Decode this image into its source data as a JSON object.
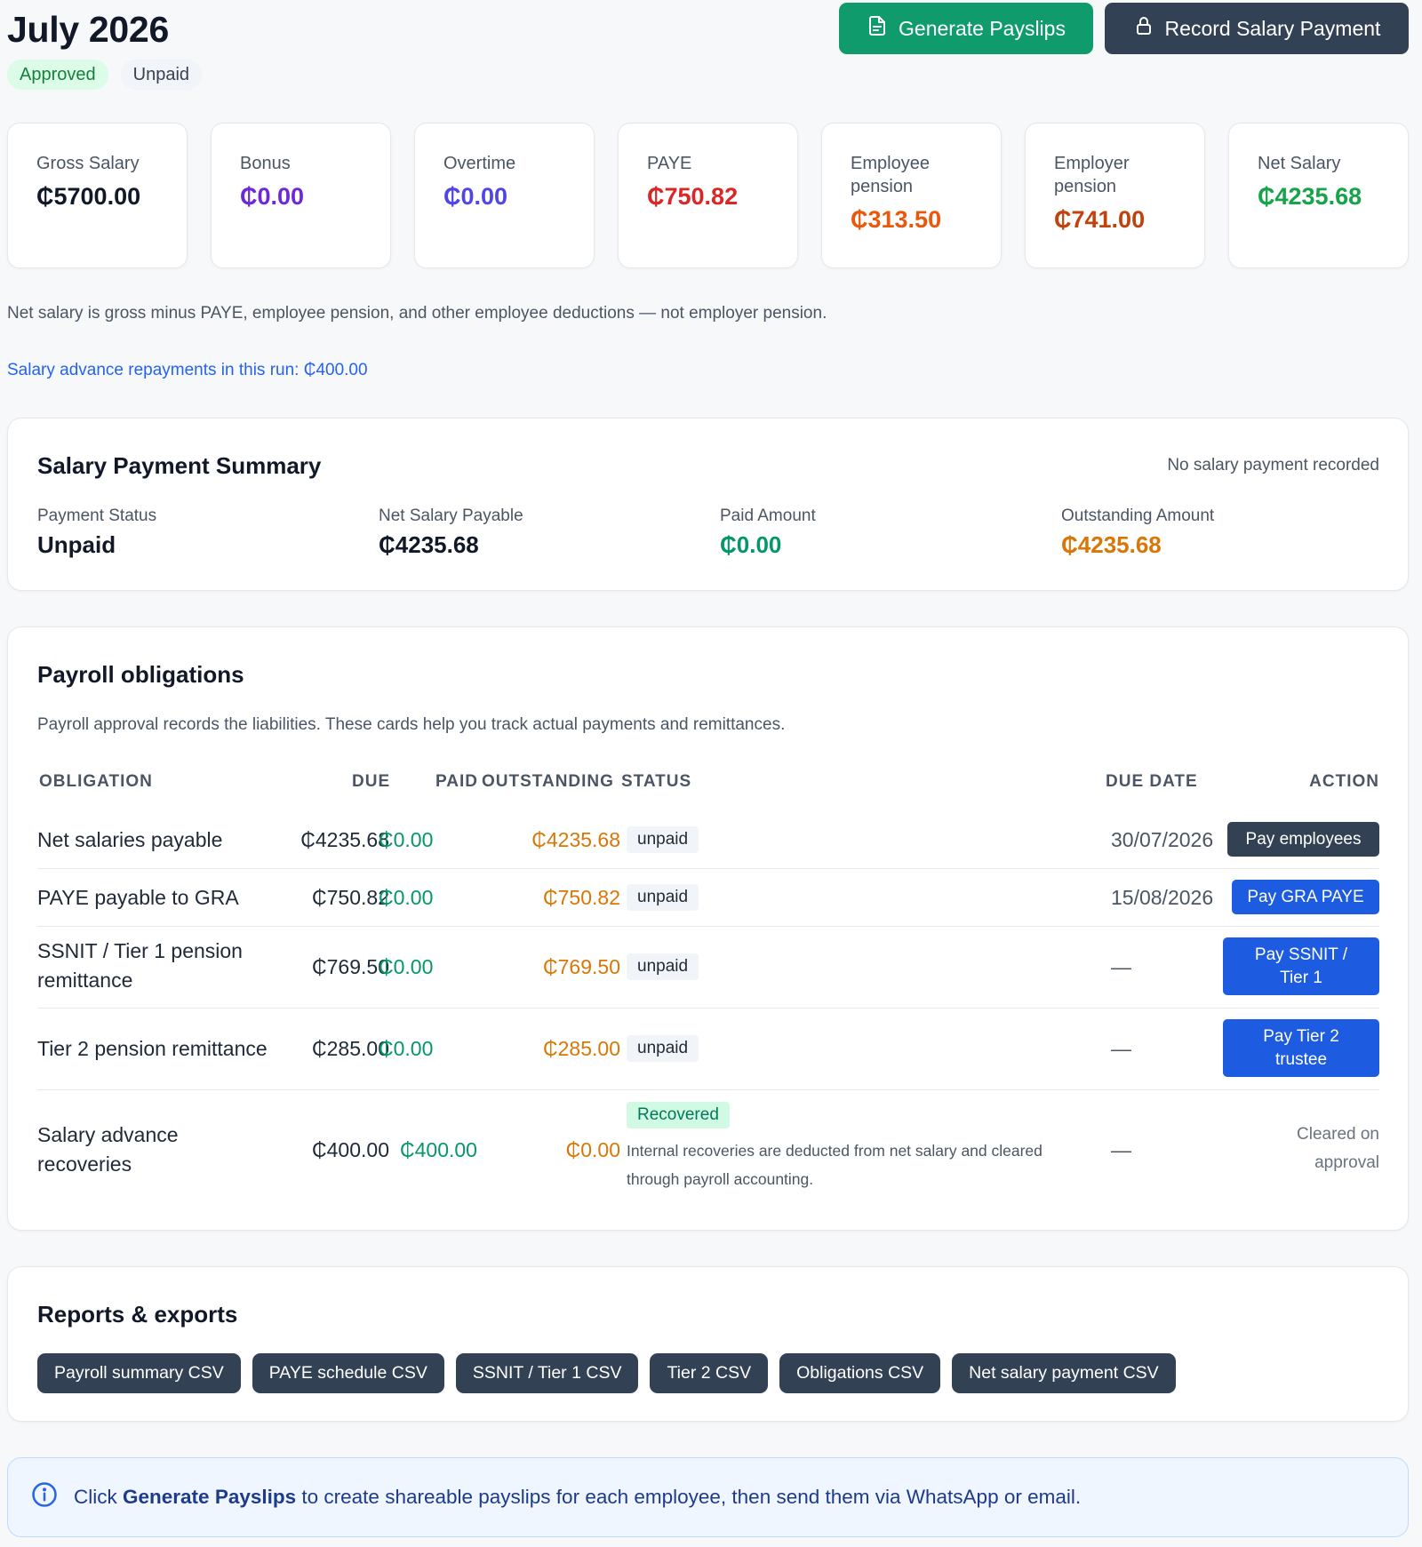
{
  "header": {
    "title": "July 2026",
    "badges": {
      "approved": "Approved",
      "unpaid": "Unpaid"
    },
    "actions": {
      "generate_payslips": "Generate Payslips",
      "record_payment": "Record Salary Payment"
    }
  },
  "stats": [
    {
      "label": "Gross Salary",
      "value": "₵5700.00",
      "color": "#111827"
    },
    {
      "label": "Bonus",
      "value": "₵0.00",
      "color": "#6d28d9"
    },
    {
      "label": "Overtime",
      "value": "₵0.00",
      "color": "#4f46e5"
    },
    {
      "label": "PAYE",
      "value": "₵750.82",
      "color": "#dc2626"
    },
    {
      "label": "Employee pension",
      "value": "₵313.50",
      "color": "#ea580c"
    },
    {
      "label": "Employer pension",
      "value": "₵741.00",
      "color": "#c2410c"
    },
    {
      "label": "Net Salary",
      "value": "₵4235.68",
      "color": "#16a34a"
    }
  ],
  "note": "Net salary is gross minus PAYE, employee pension, and other employee deductions — not employer pension.",
  "advance_link": "Salary advance repayments in this run: ₵400.00",
  "summary": {
    "title": "Salary Payment Summary",
    "no_record": "No salary payment recorded",
    "payment_status_label": "Payment Status",
    "payment_status": "Unpaid",
    "net_payable_label": "Net Salary Payable",
    "net_payable": "₵4235.68",
    "paid_label": "Paid Amount",
    "paid": "₵0.00",
    "outstanding_label": "Outstanding Amount",
    "outstanding": "₵4235.68"
  },
  "obligations": {
    "title": "Payroll obligations",
    "description": "Payroll approval records the liabilities. These cards help you track actual payments and remittances.",
    "headers": {
      "obligation": "OBLIGATION",
      "due": "DUE",
      "paid": "PAID",
      "outstanding": "OUTSTANDING",
      "status": "STATUS",
      "due_date": "DUE DATE",
      "action": "ACTION"
    },
    "rows": [
      {
        "name": "Net salaries payable",
        "due": "₵4235.68",
        "paid": "₵0.00",
        "outstanding": "₵4235.68",
        "status": "unpaid",
        "due_date": "30/07/2026",
        "action": "Pay employees"
      },
      {
        "name": "PAYE payable to GRA",
        "due": "₵750.82",
        "paid": "₵0.00",
        "outstanding": "₵750.82",
        "status": "unpaid",
        "due_date": "15/08/2026",
        "action": "Pay GRA PAYE"
      },
      {
        "name": "SSNIT / Tier 1 pension remittance",
        "due": "₵769.50",
        "paid": "₵0.00",
        "outstanding": "₵769.50",
        "status": "unpaid",
        "due_date": "—",
        "action": "Pay SSNIT / Tier 1"
      },
      {
        "name": "Tier 2 pension remittance",
        "due": "₵285.00",
        "paid": "₵0.00",
        "outstanding": "₵285.00",
        "status": "unpaid",
        "due_date": "—",
        "action": "Pay Tier 2 trustee"
      },
      {
        "name": "Salary advance recoveries",
        "due": "₵400.00",
        "paid": "₵400.00",
        "outstanding": "₵0.00",
        "status": "Recovered",
        "status_note": "Internal recoveries are deducted from net salary and cleared through payroll accounting.",
        "due_date": "—",
        "action": "Cleared on approval"
      }
    ]
  },
  "reports": {
    "title": "Reports & exports",
    "buttons": [
      "Payroll summary CSV",
      "PAYE schedule CSV",
      "SSNIT / Tier 1 CSV",
      "Tier 2 CSV",
      "Obligations CSV",
      "Net salary payment CSV"
    ]
  },
  "info": {
    "prefix": "Click",
    "highlight": "Generate Payslips",
    "suffix": "to create shareable payslips for each employee, then send them via WhatsApp or email."
  },
  "colors": {
    "green": "#0f9b6b",
    "dark": "#334155",
    "blue": "#1d5be0",
    "paid_green": "#059669",
    "outstanding_orange": "#d97706"
  }
}
